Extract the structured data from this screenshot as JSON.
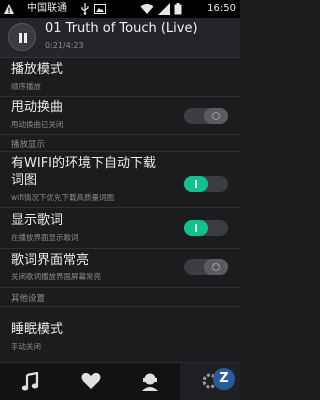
{
  "status_bar": {
    "carrier": "中国联通",
    "time": "16:50",
    "icons": [
      "warning-icon",
      "usb-icon",
      "image-icon",
      "wifi-icon",
      "signal-icon",
      "battery-icon"
    ]
  },
  "now_playing": {
    "title": "01 Truth of Touch (Live)",
    "time": "0:21/4:23",
    "state": "paused"
  },
  "settings": {
    "play_mode": {
      "title": "播放模式",
      "subtitle": "顺序播放"
    },
    "shake": {
      "title": "甩动换曲",
      "subtitle": "甩动换曲已关闭",
      "enabled": false
    },
    "section_display": "播放显示",
    "wifi_lyrics": {
      "title_line1": "有WIFI的环境下自动下载",
      "title_line2": "词图",
      "subtitle": "wifi情况下优先下载高质量词图",
      "enabled": true
    },
    "show_lyrics": {
      "title": "显示歌词",
      "subtitle": "在播放界面显示歌词",
      "enabled": true
    },
    "lyrics_screen_on": {
      "title": "歌词界面常亮",
      "subtitle": "关闭歌词播放界面屏幕常亮",
      "enabled": false
    },
    "section_other": "其他设置",
    "sleep_mode": {
      "title": "睡眠模式",
      "subtitle": "手动关闭"
    }
  },
  "bottom_nav": {
    "tabs": [
      "music-note-icon",
      "heart-icon",
      "profile-icon",
      "settings-icon"
    ],
    "active": "settings-icon"
  },
  "colors": {
    "accent": "#14c08c",
    "background": "#1b1c1e"
  }
}
